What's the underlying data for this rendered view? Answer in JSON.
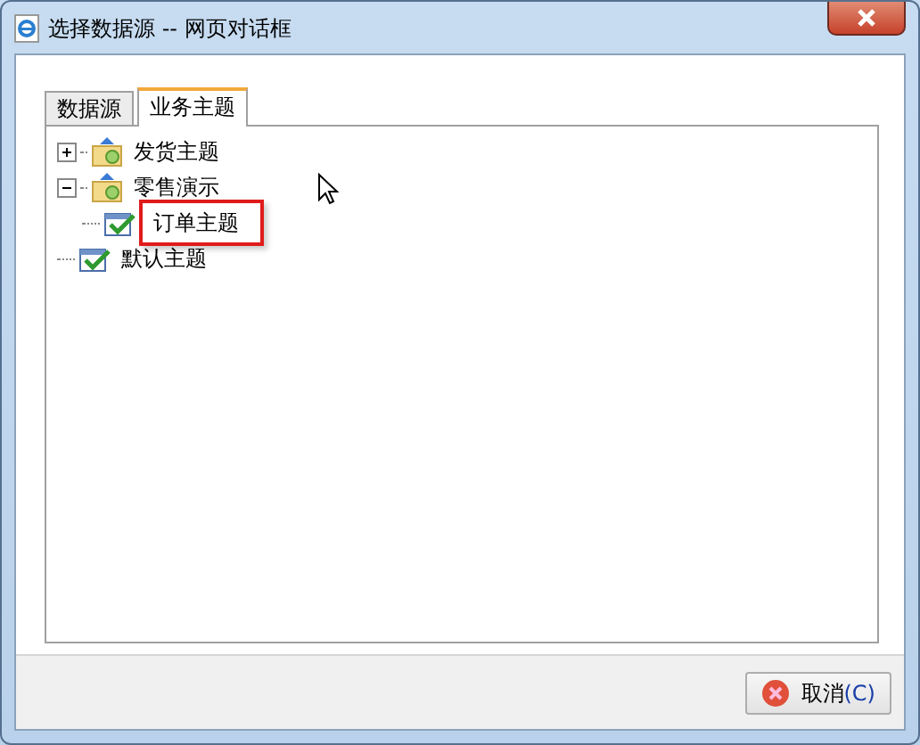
{
  "window": {
    "title": "选择数据源 -- 网页对话框"
  },
  "tabs": [
    {
      "label": "数据源",
      "selected": false
    },
    {
      "label": "业务主题",
      "selected": true
    }
  ],
  "tree": [
    {
      "label": "发货主题",
      "kind": "folder",
      "expanded": false,
      "selected": false
    },
    {
      "label": "零售演示",
      "kind": "folder",
      "expanded": true,
      "selected": false,
      "children": [
        {
          "label": "订单主题",
          "kind": "subject",
          "selected": true
        }
      ]
    },
    {
      "label": "默认主题",
      "kind": "subject",
      "selected": false
    }
  ],
  "buttons": [
    {
      "label": "取消",
      "hotkey": "(C)"
    }
  ]
}
